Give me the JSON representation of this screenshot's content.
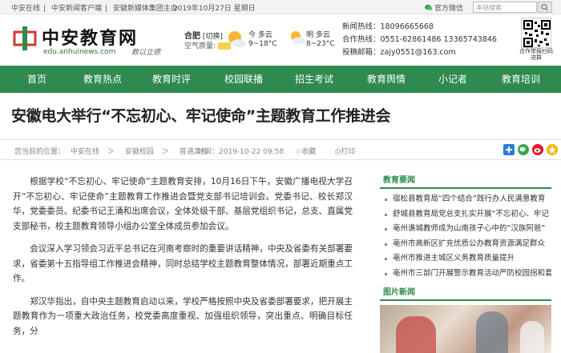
{
  "topbar": {
    "links": [
      "中安在线",
      "中安新闻客户端",
      "安徽新媒体集团主办"
    ],
    "separator": "|",
    "date": "2019年10月27日 星期日",
    "weibo_label": "官方微信",
    "search_placeholder": "本站搜索"
  },
  "header": {
    "logo_cn": "中安教育网",
    "logo_en": "edu.anhuinews.com",
    "logo_signature": "教以立德",
    "weather": {
      "city": "合肥",
      "city_tag": "[切换]",
      "air_label": "空气质量:",
      "today_label": "今 多云",
      "today_temp": "9~18°C",
      "tomorrow_label": "明 多云",
      "tomorrow_temp": "8~23°C"
    },
    "contact": {
      "hotline_label": "新闻热线：",
      "hotline": "18096665668",
      "coop_label": "合作热线：",
      "coop": "0551-62861486 13365743846",
      "mail_label": "投稿邮箱：",
      "mail": "zajy0551@163.com"
    },
    "qr_caption": "合作举报扫码进群"
  },
  "nav": {
    "items": [
      "首页",
      "教育热点",
      "教育时评",
      "校园联播",
      "招生考试",
      "教育舆情",
      "小记者",
      "教育培训"
    ]
  },
  "article": {
    "title": "安徽电大举行“不忘初心、牢记使命”主题教育工作推进会",
    "crumb": [
      "您当前的位置",
      "：",
      "中安在线",
      "＞",
      "安徽校园",
      "＞",
      "普通高校"
    ],
    "time": "时间：2019-10-22 09:58",
    "fav": "收藏",
    "print": "打印",
    "paragraphs": [
      "根据学校“不忘初心、牢记使命”主题教育安排，10月16日下午，安徽广播电视大学召开“不忘初心、牢记使命”主题教育工作推进会暨党支部书记培训会。党委书记、校长郑汉华，党委委员、纪委书记王涌和出席会议，全体处级干部、基层党组织书记，总支、直属党支部秘书，校主题教育领导小组办公室全体成员参加会议。",
      "会议深入学习领会习近平总书记在河南考察时的重要讲话精神，中央及省委有关部署要求，省委第十五指导组工作推进会精神，同时总结学校主题教育整体情况，部署近期重点工作。",
      "郑汉华指出，自中央主题教育启动以来，学校严格按照中央及省委部署要求，把开展主题教育作为一项重大政治任务，校党委高度重视、加强组织领导，突出重点、明确目标任务，分"
    ]
  },
  "sidebar": {
    "section1_title": "教育要闻",
    "news": [
      "宿松县教育局“四个结合”践行办人民满意教育",
      "舒城县教育局党总支扎实开展“不忘初心、牢记",
      "亳州谯城教师成为山南孩子心中的“汉族阿爸”",
      "亳州市高新区扩充优质公办教育资源满足群众",
      "亳州市推进主城区义务教育质量提升",
      "亳州市三部门开展警示教育活动严防校园拐和套"
    ],
    "section2_title": "图片新闻"
  }
}
